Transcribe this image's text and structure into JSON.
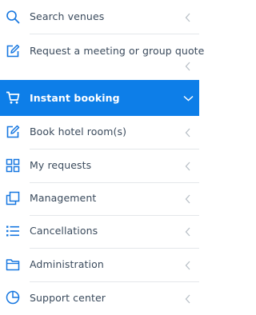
{
  "menu": {
    "items": [
      {
        "label": "Search venues",
        "icon": "search-icon"
      },
      {
        "label": "Request a meeting or group quote",
        "icon": "edit-icon"
      },
      {
        "label": "Instant booking",
        "icon": "cart-icon",
        "active": true
      },
      {
        "label": "Book hotel room(s)",
        "icon": "edit-icon"
      },
      {
        "label": "My requests",
        "icon": "grid-icon"
      },
      {
        "label": "Management",
        "icon": "copy-icon"
      },
      {
        "label": "Cancellations",
        "icon": "list-icon"
      },
      {
        "label": "Administration",
        "icon": "folder-icon"
      },
      {
        "label": "Support center",
        "icon": "pie-chart-icon"
      }
    ]
  },
  "colors": {
    "accent": "#0d7ee8",
    "icon": "#1677e0",
    "text": "#3a4a5c",
    "chevron": "#b8bfc6"
  }
}
